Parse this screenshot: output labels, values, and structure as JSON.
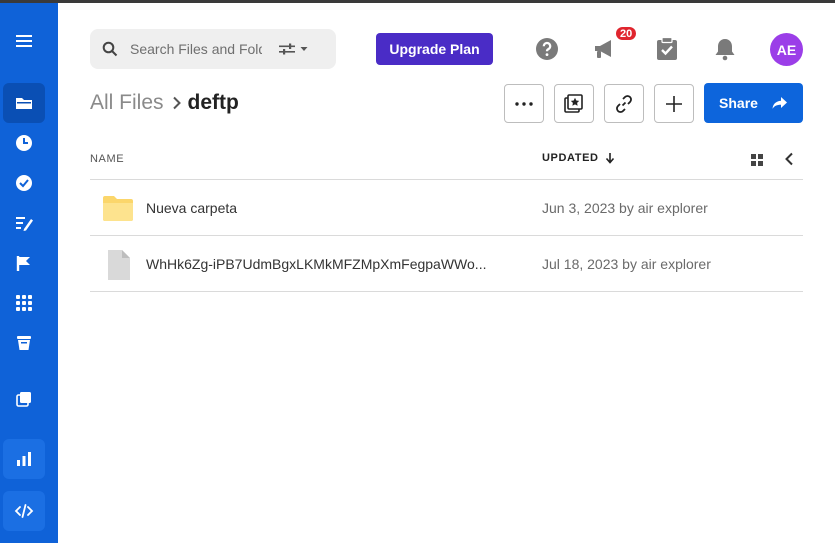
{
  "search": {
    "placeholder": "Search Files and Folde"
  },
  "header": {
    "upgrade_label": "Upgrade Plan",
    "notification_count": "20",
    "avatar_initials": "AE"
  },
  "breadcrumb": {
    "root": "All Files",
    "current": "deftp"
  },
  "toolbar": {
    "share_label": "Share"
  },
  "table": {
    "col_name": "NAME",
    "col_updated": "UPDATED",
    "rows": [
      {
        "name": "Nueva carpeta",
        "updated": "Jun 3, 2023 by air explorer",
        "kind": "folder-icon"
      },
      {
        "name": "WhHk6Zg-iPB7UdmBgxLKMkMFZMpXmFegpaWWo...",
        "updated": "Jul 18, 2023 by air explorer",
        "kind": "file-icon"
      }
    ]
  },
  "colors": {
    "sidebar": "#0f62d8",
    "upgrade": "#4a2cc6",
    "share": "#0d65dc",
    "avatar": "#9b3ee8",
    "badge": "#e0252e"
  }
}
